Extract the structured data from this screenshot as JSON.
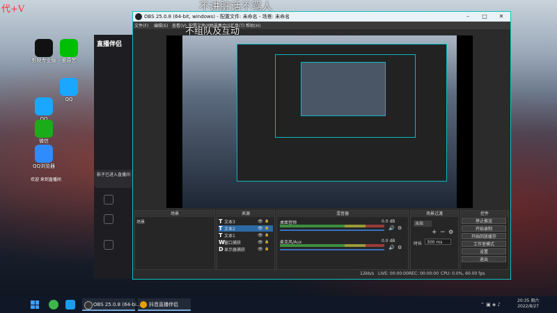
{
  "overlay": {
    "top_text": "不讲脏话不骂人",
    "mid_text": "不组队及互动",
    "corner_text": "代+V"
  },
  "desktop_icons": [
    {
      "label": "剪映专业版",
      "color": "#111"
    },
    {
      "label": "QQ",
      "color": "#1aa7ff"
    },
    {
      "label": "微信",
      "color": "#1aad19"
    },
    {
      "label": "QQ浏览器",
      "color": "#2f8cff"
    },
    {
      "label": "爱奇艺",
      "color": "#00be06"
    },
    {
      "label": "QQ",
      "color": "#1aa7ff"
    }
  ],
  "zhibo": {
    "logo": "直播伴侣",
    "welcome": "欢迎 来到直播间",
    "popup": "影子已进入直播间"
  },
  "obs": {
    "title": "OBS 25.0.8 (64-bit, windows) - 配置文件: 未命名 - 场景: 未命名",
    "menu": [
      "文件(F)",
      "编辑(E)",
      "查看(V)",
      "配置文件(P)",
      "场景集合(S)",
      "工具(T)",
      "帮助(H)"
    ],
    "docks": {
      "scenes": "场景",
      "sources": "来源",
      "mixer": "混音器",
      "transitions": "场景过渡",
      "controls": "控件"
    },
    "scene_list": [
      "场景"
    ],
    "sources": [
      {
        "label": "文本3",
        "type": "T",
        "selected": false
      },
      {
        "label": "文本2",
        "type": "T",
        "selected": true
      },
      {
        "label": "文本1",
        "type": "T",
        "selected": false
      },
      {
        "label": "窗口捕获",
        "type": "W",
        "selected": false
      },
      {
        "label": "显示器捕获",
        "type": "D",
        "selected": false
      }
    ],
    "mixer": [
      {
        "name": "桌面音频",
        "level": "0.0 dB"
      },
      {
        "name": "麦克风/Aux",
        "level": "0.0 dB"
      }
    ],
    "transition": {
      "name": "淡出",
      "duration_label": "时长",
      "duration": "300 ms"
    },
    "controls": [
      "停止推流",
      "开始录制",
      "开始回放缓存",
      "工作室模式",
      "设置",
      "退出"
    ],
    "status": {
      "live": "LIVE: 00:00:00",
      "rec": "REC: 00:00:00",
      "cpu": "CPU: 0.0%, 60.00 fps",
      "kb": "12kb/s"
    }
  },
  "taskbar": {
    "apps": [
      "OBS 25.0.8 (64-bi...",
      "抖音直播伴侣"
    ],
    "time": "20:35 周六",
    "date": "2022/8/27"
  }
}
